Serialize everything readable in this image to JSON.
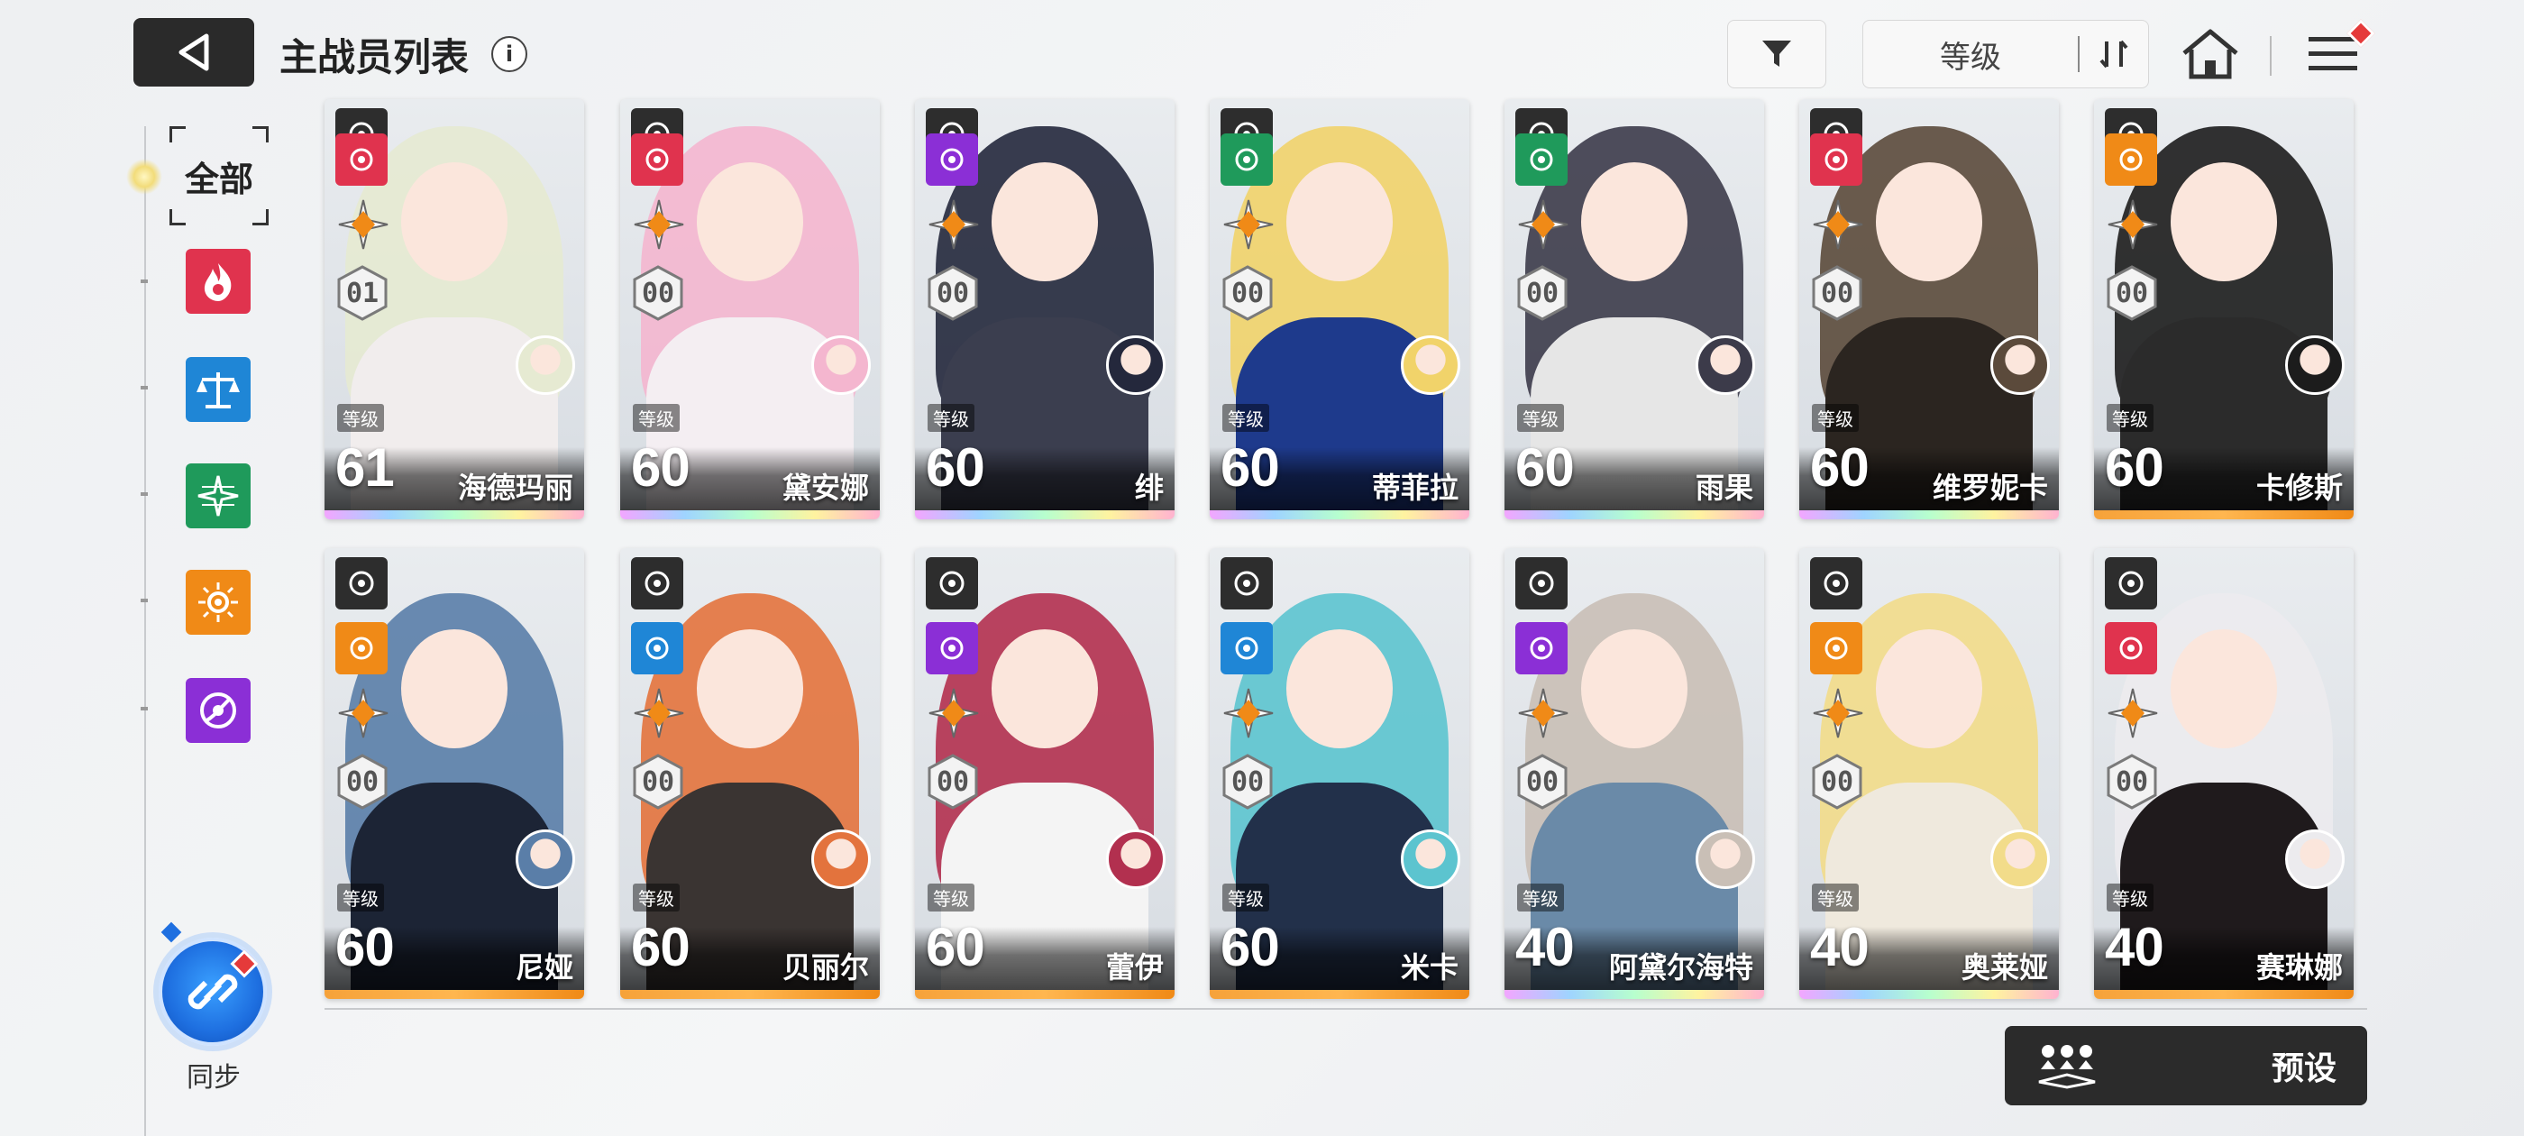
{
  "header": {
    "back_icon": "back-arrow-icon",
    "title": "主战员列表",
    "info_icon": "i",
    "filter_icon": "funnel-icon",
    "sort_label": "等级",
    "sort_toggle_icon": "sort-toggle-icon",
    "home_icon": "home-icon",
    "menu_icon": "hamburger-menu-icon"
  },
  "sidebar": {
    "all_label": "全部",
    "elements": [
      {
        "name": "fire",
        "color": "#e0334e",
        "icon": "flame-icon"
      },
      {
        "name": "balance",
        "color": "#1f86d6",
        "icon": "scales-icon"
      },
      {
        "name": "wind",
        "color": "#1f9a5b",
        "icon": "wind-star-icon"
      },
      {
        "name": "light",
        "color": "#f08a17",
        "icon": "sun-icon"
      },
      {
        "name": "void",
        "color": "#8b2fd6",
        "icon": "void-swirl-icon"
      }
    ],
    "sync_label": "同步",
    "sync_icon": "sync-link-icon"
  },
  "level_tag": "等级",
  "cards": [
    {
      "name": "海德玛丽",
      "level": "61",
      "badge": "01",
      "element": "#e0334e",
      "hair": "#e6ead2",
      "body": "#f1eded",
      "rarity": "rainbow"
    },
    {
      "name": "黛安娜",
      "level": "60",
      "badge": "00",
      "element": "#e0334e",
      "hair": "#f4b6cf",
      "body": "#f4eef2",
      "rarity": "rainbow"
    },
    {
      "name": "绯",
      "level": "60",
      "badge": "00",
      "element": "#8b2fd6",
      "hair": "#24283c",
      "body": "#3b3e4f",
      "rarity": "rainbow"
    },
    {
      "name": "蒂菲拉",
      "level": "60",
      "badge": "00",
      "element": "#1f9a5b",
      "hair": "#f1d36a",
      "body": "#1e3a8c",
      "rarity": "rainbow"
    },
    {
      "name": "雨果",
      "level": "60",
      "badge": "00",
      "element": "#1f9a5b",
      "hair": "#3c3b4a",
      "body": "#e6e6e6",
      "rarity": "rainbow"
    },
    {
      "name": "维罗妮卡",
      "level": "60",
      "badge": "00",
      "element": "#e0334e",
      "hair": "#5b4a3b",
      "body": "#2b2520",
      "rarity": "rainbow"
    },
    {
      "name": "卡修斯",
      "level": "60",
      "badge": "00",
      "element": "#f08a17",
      "hair": "#1c1c1c",
      "body": "#2b2b2b",
      "rarity": "orange"
    },
    {
      "name": "尼娅",
      "level": "60",
      "badge": "00",
      "element": "#f08a17",
      "hair": "#5a7ea8",
      "body": "#1c2435",
      "rarity": "orange"
    },
    {
      "name": "贝丽尔",
      "level": "60",
      "badge": "00",
      "element": "#1f86d6",
      "hair": "#e3733d",
      "body": "#3a3432",
      "rarity": "orange"
    },
    {
      "name": "蕾伊",
      "level": "60",
      "badge": "00",
      "element": "#8b2fd6",
      "hair": "#b2304f",
      "body": "#f4f4f4",
      "rarity": "orange"
    },
    {
      "name": "米卡",
      "level": "60",
      "badge": "00",
      "element": "#1f86d6",
      "hair": "#5cc4cf",
      "body": "#22304a",
      "rarity": "orange"
    },
    {
      "name": "阿黛尔海特",
      "level": "40",
      "badge": "00",
      "element": "#8b2fd6",
      "hair": "#c9bfb6",
      "body": "#6a8aa8",
      "rarity": "rainbow"
    },
    {
      "name": "奥莱娅",
      "level": "40",
      "badge": "00",
      "element": "#f08a17",
      "hair": "#f2dc8a",
      "body": "#efe9dd",
      "rarity": "rainbow"
    },
    {
      "name": "赛琳娜",
      "level": "40",
      "badge": "00",
      "element": "#e0334e",
      "hair": "#ecebee",
      "body": "#1f1a1c",
      "rarity": "orange"
    }
  ],
  "preset": {
    "label": "预设",
    "icon": "team-preset-icon"
  },
  "colors": {
    "dark_button": "#2b2b2b",
    "accent_blue": "#1e6fe0",
    "notify_red": "#e53a3a"
  }
}
